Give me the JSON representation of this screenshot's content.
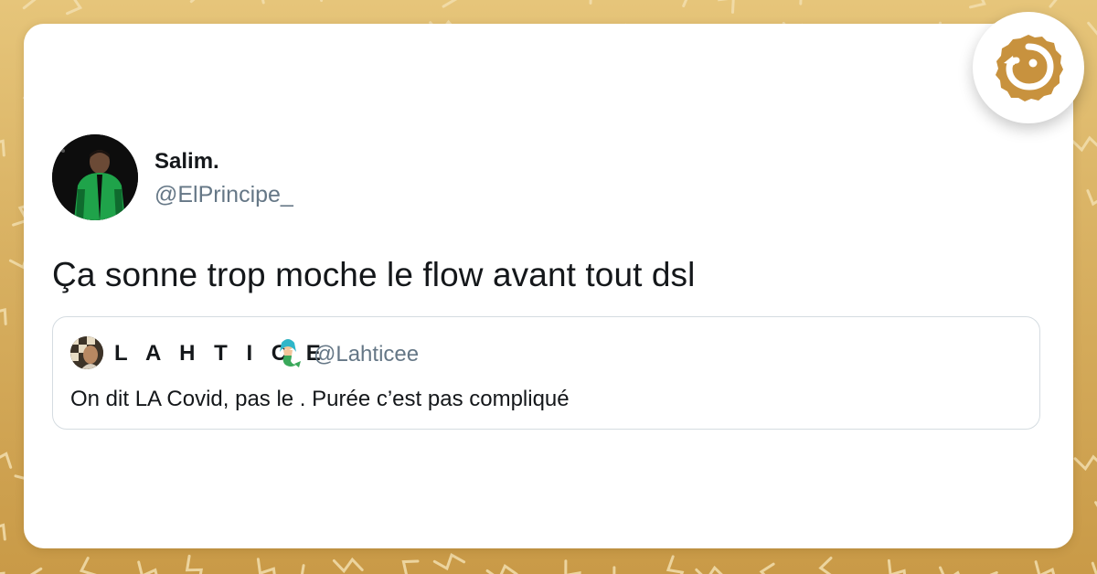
{
  "tweet": {
    "author": {
      "name": "Salim.",
      "handle": "@ElPrincipe_"
    },
    "text": "Ça sonne trop moche le flow avant tout dsl",
    "quoted": {
      "name": "L A H T I C E",
      "emoji": "mermaid-emoji",
      "handle": "@Lahticee",
      "text": "On dit LA Covid, pas le . Purée c’est pas compliqué"
    }
  },
  "brand": {
    "logo": "chick-logo-icon"
  },
  "colors": {
    "background_gold": "#d8b061",
    "pattern_line": "#f3dfae",
    "card": "#ffffff",
    "text_primary": "#14171a",
    "text_secondary": "#657786",
    "quote_border": "#d5dce1",
    "brand_gold": "#c8923e"
  }
}
